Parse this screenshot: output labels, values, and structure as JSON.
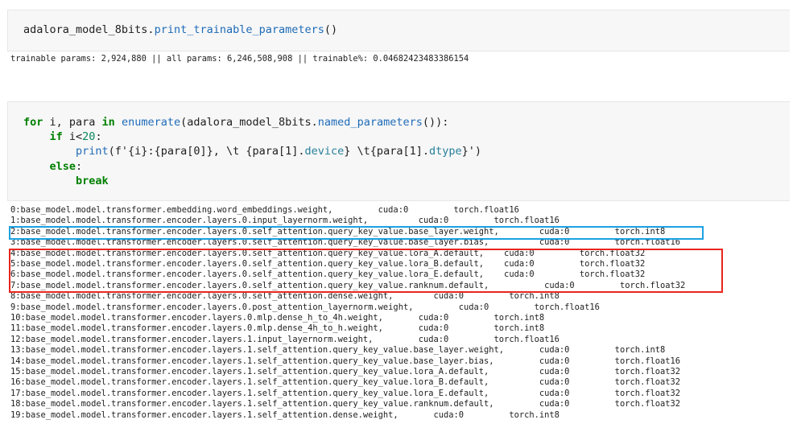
{
  "cells": [
    {
      "code_lines": [
        [
          {
            "t": "adalora_model_8bits.",
            "c": ""
          },
          {
            "t": "print_trainable_parameters",
            "c": "fn"
          },
          {
            "t": "()",
            "c": ""
          }
        ]
      ],
      "output": "trainable params: 2,924,880 || all params: 6,246,508,908 || trainable%: 0.04682423483386154"
    },
    {
      "code_lines": [
        [
          {
            "t": "for",
            "c": "kw"
          },
          {
            "t": " i, para ",
            "c": ""
          },
          {
            "t": "in",
            "c": "kw"
          },
          {
            "t": " ",
            "c": ""
          },
          {
            "t": "enumerate",
            "c": "fn"
          },
          {
            "t": "(adalora_model_8bits.",
            "c": ""
          },
          {
            "t": "named_parameters",
            "c": "fn"
          },
          {
            "t": "()):",
            "c": ""
          }
        ],
        [
          {
            "t": "    ",
            "c": ""
          },
          {
            "t": "if",
            "c": "kw"
          },
          {
            "t": " i<",
            "c": ""
          },
          {
            "t": "20",
            "c": "num"
          },
          {
            "t": ":",
            "c": ""
          }
        ],
        [
          {
            "t": "        ",
            "c": ""
          },
          {
            "t": "print",
            "c": "fn"
          },
          {
            "t": "(f'{i}:{para[0]}, \\t {para[1].",
            "c": ""
          },
          {
            "t": "device",
            "c": "cls"
          },
          {
            "t": "} \\t{para[1].",
            "c": ""
          },
          {
            "t": "dtype",
            "c": "cls"
          },
          {
            "t": "}')",
            "c": ""
          }
        ],
        [
          {
            "t": "    ",
            "c": ""
          },
          {
            "t": "else",
            "c": "kw"
          },
          {
            "t": ":",
            "c": ""
          }
        ],
        [
          {
            "t": "        ",
            "c": ""
          },
          {
            "t": "break",
            "c": "kw"
          }
        ]
      ],
      "output_lines": [
        "0:base_model.model.transformer.embedding.word_embeddings.weight,         cuda:0         torch.float16",
        "1:base_model.model.transformer.encoder.layers.0.input_layernorm.weight,          cuda:0         torch.float16",
        "2:base_model.model.transformer.encoder.layers.0.self_attention.query_key_value.base_layer.weight,        cuda:0         torch.int8",
        "3:base_model.model.transformer.encoder.layers.0.self_attention.query_key_value.base_layer.bias,          cuda:0         torch.float16",
        "4:base_model.model.transformer.encoder.layers.0.self_attention.query_key_value.lora_A.default,    cuda:0         torch.float32",
        "5:base_model.model.transformer.encoder.layers.0.self_attention.query_key_value.lora_B.default,    cuda:0         torch.float32",
        "6:base_model.model.transformer.encoder.layers.0.self_attention.query_key_value.lora_E.default,    cuda:0         torch.float32",
        "7:base_model.model.transformer.encoder.layers.0.self_attention.query_key_value.ranknum.default,           cuda:0         torch.float32",
        "8:base_model.model.transformer.encoder.layers.0.self_attention.dense.weight,        cuda:0         torch.int8",
        "9:base_model.model.transformer.encoder.layers.0.post_attention_layernorm.weight,         cuda:0         torch.float16",
        "10:base_model.model.transformer.encoder.layers.0.mlp.dense_h_to_4h.weight,       cuda:0         torch.int8",
        "11:base_model.model.transformer.encoder.layers.0.mlp.dense_4h_to_h.weight,       cuda:0         torch.int8",
        "12:base_model.model.transformer.encoder.layers.1.input_layernorm.weight,         cuda:0         torch.float16",
        "13:base_model.model.transformer.encoder.layers.1.self_attention.query_key_value.base_layer.weight,       cuda:0         torch.int8",
        "14:base_model.model.transformer.encoder.layers.1.self_attention.query_key_value.base_layer.bias,         cuda:0         torch.float16",
        "15:base_model.model.transformer.encoder.layers.1.self_attention.query_key_value.lora_A.default,          cuda:0         torch.float32",
        "16:base_model.model.transformer.encoder.layers.1.self_attention.query_key_value.lora_B.default,          cuda:0         torch.float32",
        "17:base_model.model.transformer.encoder.layers.1.self_attention.query_key_value.lora_E.default,          cuda:0         torch.float32",
        "18:base_model.model.transformer.encoder.layers.1.self_attention.query_key_value.ranknum.default,         cuda:0         torch.float32",
        "19:base_model.model.transformer.encoder.layers.1.self_attention.dense.weight,       cuda:0         torch.int8"
      ]
    }
  ],
  "highlights": {
    "blue_color": "#1ba1e2",
    "red_color": "#e8261d"
  }
}
